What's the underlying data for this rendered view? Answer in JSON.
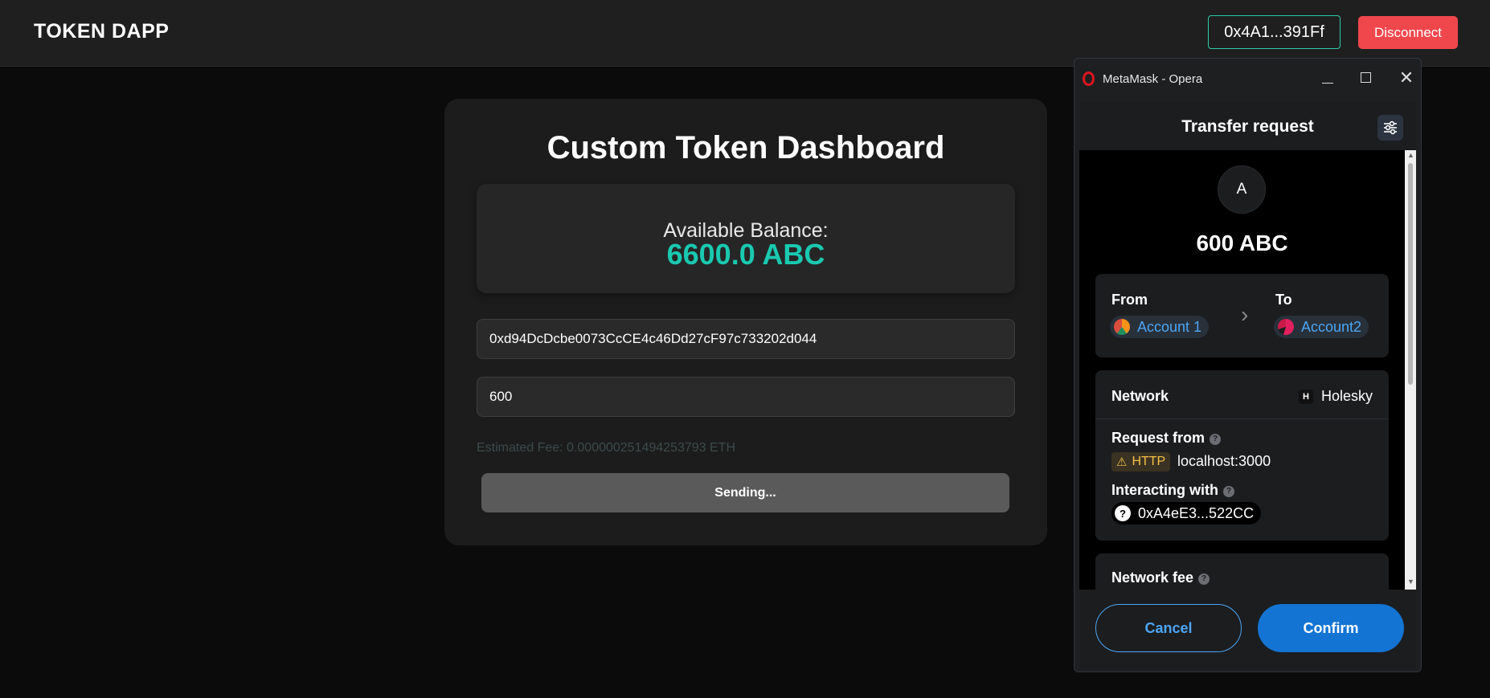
{
  "header": {
    "brand": "TOKEN DAPP",
    "address": "0x4A1...391Ff",
    "disconnect_label": "Disconnect"
  },
  "dashboard": {
    "title": "Custom Token Dashboard",
    "balance_label": "Available Balance:",
    "balance_value": "6600.0 ABC",
    "recipient_value": "0xd94DcDcbe0073CcCE4c46Dd27cF97c733202d044",
    "amount_value": "600",
    "estimated_fee": "Estimated Fee: 0.000000251494253793 ETH",
    "send_label": "Sending..."
  },
  "metamask": {
    "window_title": "MetaMask - Opera",
    "header_title": "Transfer request",
    "avatar_letter": "A",
    "amount": "600 ABC",
    "from_label": "From",
    "to_label": "To",
    "from_account": "Account 1",
    "to_account": "Account2",
    "network_label": "Network",
    "network_icon_letter": "H",
    "network_value": "Holesky",
    "request_from_label": "Request from",
    "http_label": "HTTP",
    "request_host": "localhost:3000",
    "interacting_label": "Interacting with",
    "contract_address": "0xA4eE3...522CC",
    "network_fee_label": "Network fee",
    "cancel_label": "Cancel",
    "confirm_label": "Confirm"
  },
  "colors": {
    "accent_teal": "#19c9b0",
    "disconnect_red": "#f0474d",
    "metamask_blue": "#1374d4",
    "link_blue": "#4ca6f5",
    "warning_yellow": "#f5c04a"
  }
}
